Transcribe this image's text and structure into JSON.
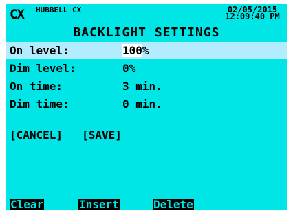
{
  "header": {
    "logo": "CX",
    "brand": "HUBBELL CX",
    "date": "02/05/2015",
    "time": "12:09:40 PM"
  },
  "title": "BACKLIGHT SETTINGS",
  "rows": [
    {
      "label": "On level:",
      "value_edit": "100",
      "value_suffix": "%"
    },
    {
      "label": "Dim level:",
      "value": "0%"
    },
    {
      "label": "On time:",
      "value": "3 min."
    },
    {
      "label": "Dim time:",
      "value": "0 min."
    }
  ],
  "buttons": {
    "cancel": "[CANCEL]",
    "save": "[SAVE]"
  },
  "softkeys": {
    "clear": "Clear",
    "insert": "Insert",
    "delete": "Delete"
  },
  "colors": {
    "screen": "#00e5e5",
    "selected_row": "#b3ecff",
    "softkey_bg": "#000000"
  }
}
